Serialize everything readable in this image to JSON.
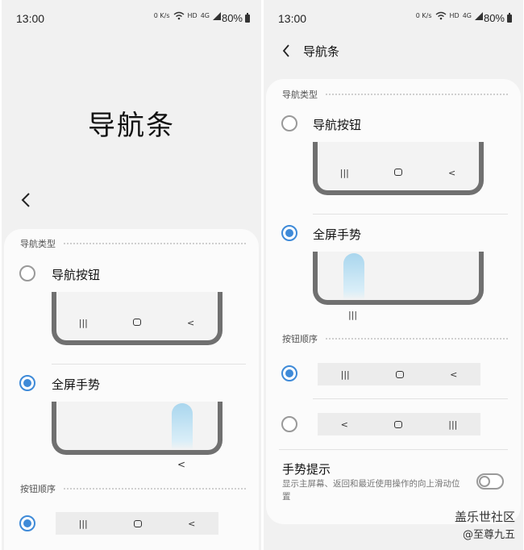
{
  "status": {
    "time": "13:00",
    "speed": "0 K/s",
    "hd": "HD",
    "net": "4G",
    "battery": "80%"
  },
  "left": {
    "title": "导航条",
    "section_type": "导航类型",
    "options": [
      {
        "label": "导航按钮",
        "selected": false
      },
      {
        "label": "全屏手势",
        "selected": true
      }
    ],
    "section_order": "按钮顺序"
  },
  "right": {
    "header_title": "导航条",
    "section_type": "导航类型",
    "options": [
      {
        "label": "导航按钮",
        "selected": false
      },
      {
        "label": "全屏手势",
        "selected": true
      }
    ],
    "section_order": "按钮顺序",
    "order_options": [
      {
        "glyphs": [
          "|||",
          "○",
          "<"
        ],
        "selected": true
      },
      {
        "glyphs": [
          "<",
          "○",
          "|||"
        ],
        "selected": false
      }
    ],
    "hint": {
      "title": "手势提示",
      "description": "显示主屏幕、返回和最近使用操作的向上滑动位置",
      "enabled": false
    }
  },
  "nav_glyphs": {
    "recents": "|||",
    "back": "<"
  },
  "watermark": {
    "line1": "盖乐世社区",
    "line2": "@至尊九五"
  },
  "colors": {
    "accent": "#3e8ad8",
    "background": "#f1f1f1",
    "card": "#fbfbfb"
  },
  "icons": [
    "back-arrow-icon",
    "wifi-icon",
    "battery-icon",
    "recents-icon",
    "home-icon",
    "back-icon"
  ]
}
